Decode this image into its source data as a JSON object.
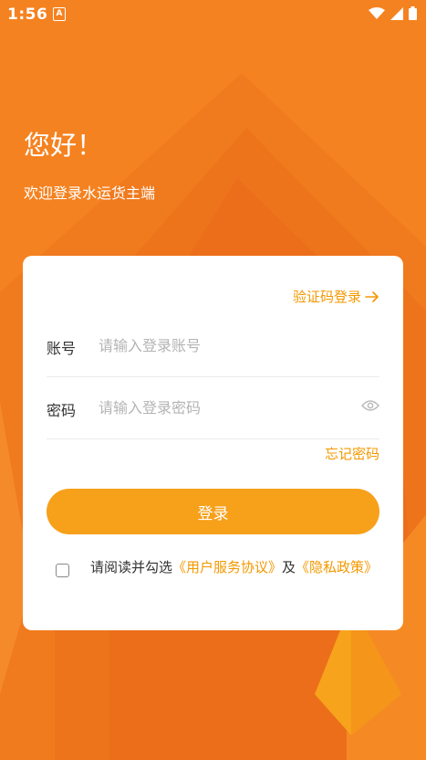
{
  "status_bar": {
    "time": "1:56",
    "notification_badge": "A"
  },
  "header": {
    "greeting": "您好！",
    "subtitle": "欢迎登录水运货主端"
  },
  "form": {
    "switch_login_label": "验证码登录",
    "account_label": "账号",
    "account_placeholder": "请输入登录账号",
    "password_label": "密码",
    "password_placeholder": "请输入登录密码",
    "forgot_label": "忘记密码",
    "login_label": "登录"
  },
  "agreement": {
    "prefix": "请阅读并勾选",
    "user_agreement": "《用户服务协议》",
    "conjunction": "及",
    "privacy_policy": "《隐私政策》",
    "checked": false
  },
  "colors": {
    "background": "#F58220",
    "accent": "#F39800",
    "button": "#F7A01A"
  }
}
